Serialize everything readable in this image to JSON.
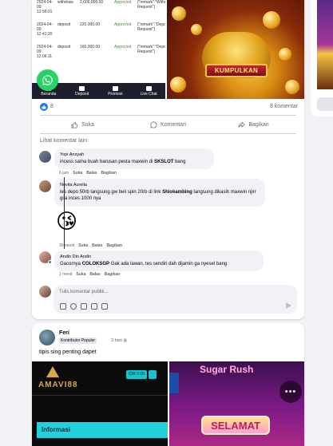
{
  "post1": {
    "transactions": [
      {
        "date": "2024-04-09 12:56:01",
        "type": "withdraw",
        "amount": "2,600,000.00",
        "status": "Approved",
        "remark": "{\"remark\":\"Withdraw Request\"}"
      },
      {
        "date": "2024-04-09 12:41:20",
        "type": "deposit",
        "amount": "220,000.00",
        "status": "Approved",
        "remark": "{\"remark\":\"Deposit Request\"}"
      },
      {
        "date": "2024-04-09 12:06:11",
        "type": "deposit",
        "amount": "160,000.00",
        "status": "Approved",
        "remark": "{\"remark\":\"Deposit Request\"}"
      }
    ],
    "app_nav": [
      "Beranda",
      "Deposit",
      "Promosi",
      "Live Chat"
    ],
    "game_button": "KUMPULKAN",
    "reaction_count": "8",
    "comment_count": "8 komentar",
    "actions": {
      "like": "Suka",
      "comment": "Komentari",
      "share": "Bagikan"
    },
    "see_more": "Lihat komentar lain",
    "comments": [
      {
        "name": "Yopi Ansyah",
        "text_pre": "incess sama buah barusan pesta maxwin di ",
        "text_bold": "SKSLOT",
        "text_post": " bang",
        "time": "6 jam",
        "like": "Suka",
        "reply": "Balas",
        "share": "Bagikan"
      },
      {
        "name": "Novita Aurelia",
        "text_pre": "tes depo 50rb langsung gw beli spin 20rb di link ",
        "text_bold": "Shiokambing",
        "text_post": " langsung dikasih maxwin njirr gila inces 1000 nya",
        "time": "",
        "like": "Suka",
        "reply": "Balas",
        "share": "Bagikan"
      },
      {
        "name": "",
        "sticker": "😘",
        "time": "30 menit",
        "like": "Suka",
        "reply": "Balas",
        "share": "Bagikan"
      },
      {
        "name": "Andin Din Andin",
        "text_pre": "Gacornya ",
        "text_bold": "COLOKSGP",
        "text_post": " Gak ada lawan, tes sendiri dah dijamin ga nyesel bang",
        "time": "1 menit",
        "like": "Suka",
        "reply": "Balas",
        "share": "Bagikan"
      }
    ],
    "write_placeholder": "Tulis komentar publik..."
  },
  "post2": {
    "author": "Feri",
    "badge": "Kontributor Populer",
    "time": "3 hari",
    "text": "tipis sing penting dapet",
    "left_image": {
      "brand": "AMAVI88",
      "balance": "IDR 0.00",
      "section": "Informasi"
    },
    "right_image": {
      "title": "Sugar Rush",
      "banner": "SELAMAT",
      "more": "•••"
    }
  },
  "colors": {
    "accent": "#1877f2",
    "whatsapp": "#25d366",
    "approved": "#2e9b3b"
  }
}
